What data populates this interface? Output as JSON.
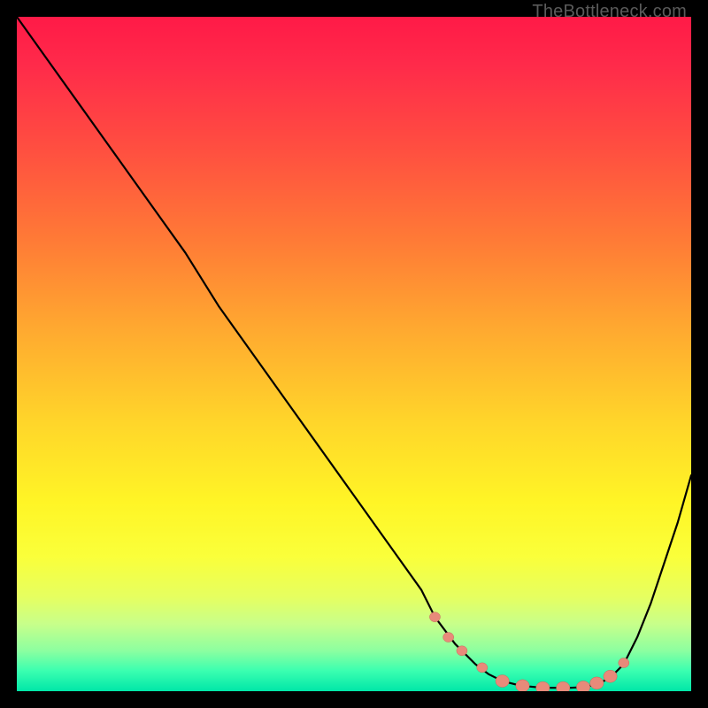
{
  "watermark": "TheBottleneck.com",
  "colors": {
    "page_bg": "#000000",
    "curve": "#000000",
    "marker_fill": "#e88a7a",
    "marker_stroke": "#c76a5a"
  },
  "chart_data": {
    "type": "line",
    "title": "",
    "xlabel": "",
    "ylabel": "",
    "xlim": [
      0,
      100
    ],
    "ylim": [
      0,
      100
    ],
    "grid": false,
    "legend": false,
    "x": [
      0,
      5,
      10,
      15,
      20,
      25,
      30,
      35,
      40,
      45,
      50,
      55,
      60,
      62,
      65,
      68,
      70,
      72,
      74,
      76,
      78,
      80,
      82,
      84,
      86,
      88,
      90,
      92,
      94,
      96,
      98,
      100
    ],
    "y": [
      100,
      93,
      86,
      79,
      72,
      65,
      57,
      50,
      43,
      36,
      29,
      22,
      15,
      11,
      7,
      4,
      2.5,
      1.5,
      1,
      0.7,
      0.5,
      0.5,
      0.5,
      0.6,
      1,
      2,
      4,
      8,
      13,
      19,
      25,
      32
    ],
    "markers_x": [
      62,
      64,
      66,
      69,
      72,
      75,
      78,
      81,
      84,
      86,
      88,
      90
    ],
    "markers_y": [
      11,
      8,
      6,
      3.5,
      1.5,
      0.8,
      0.5,
      0.5,
      0.6,
      1.2,
      2.2,
      4.2
    ]
  }
}
